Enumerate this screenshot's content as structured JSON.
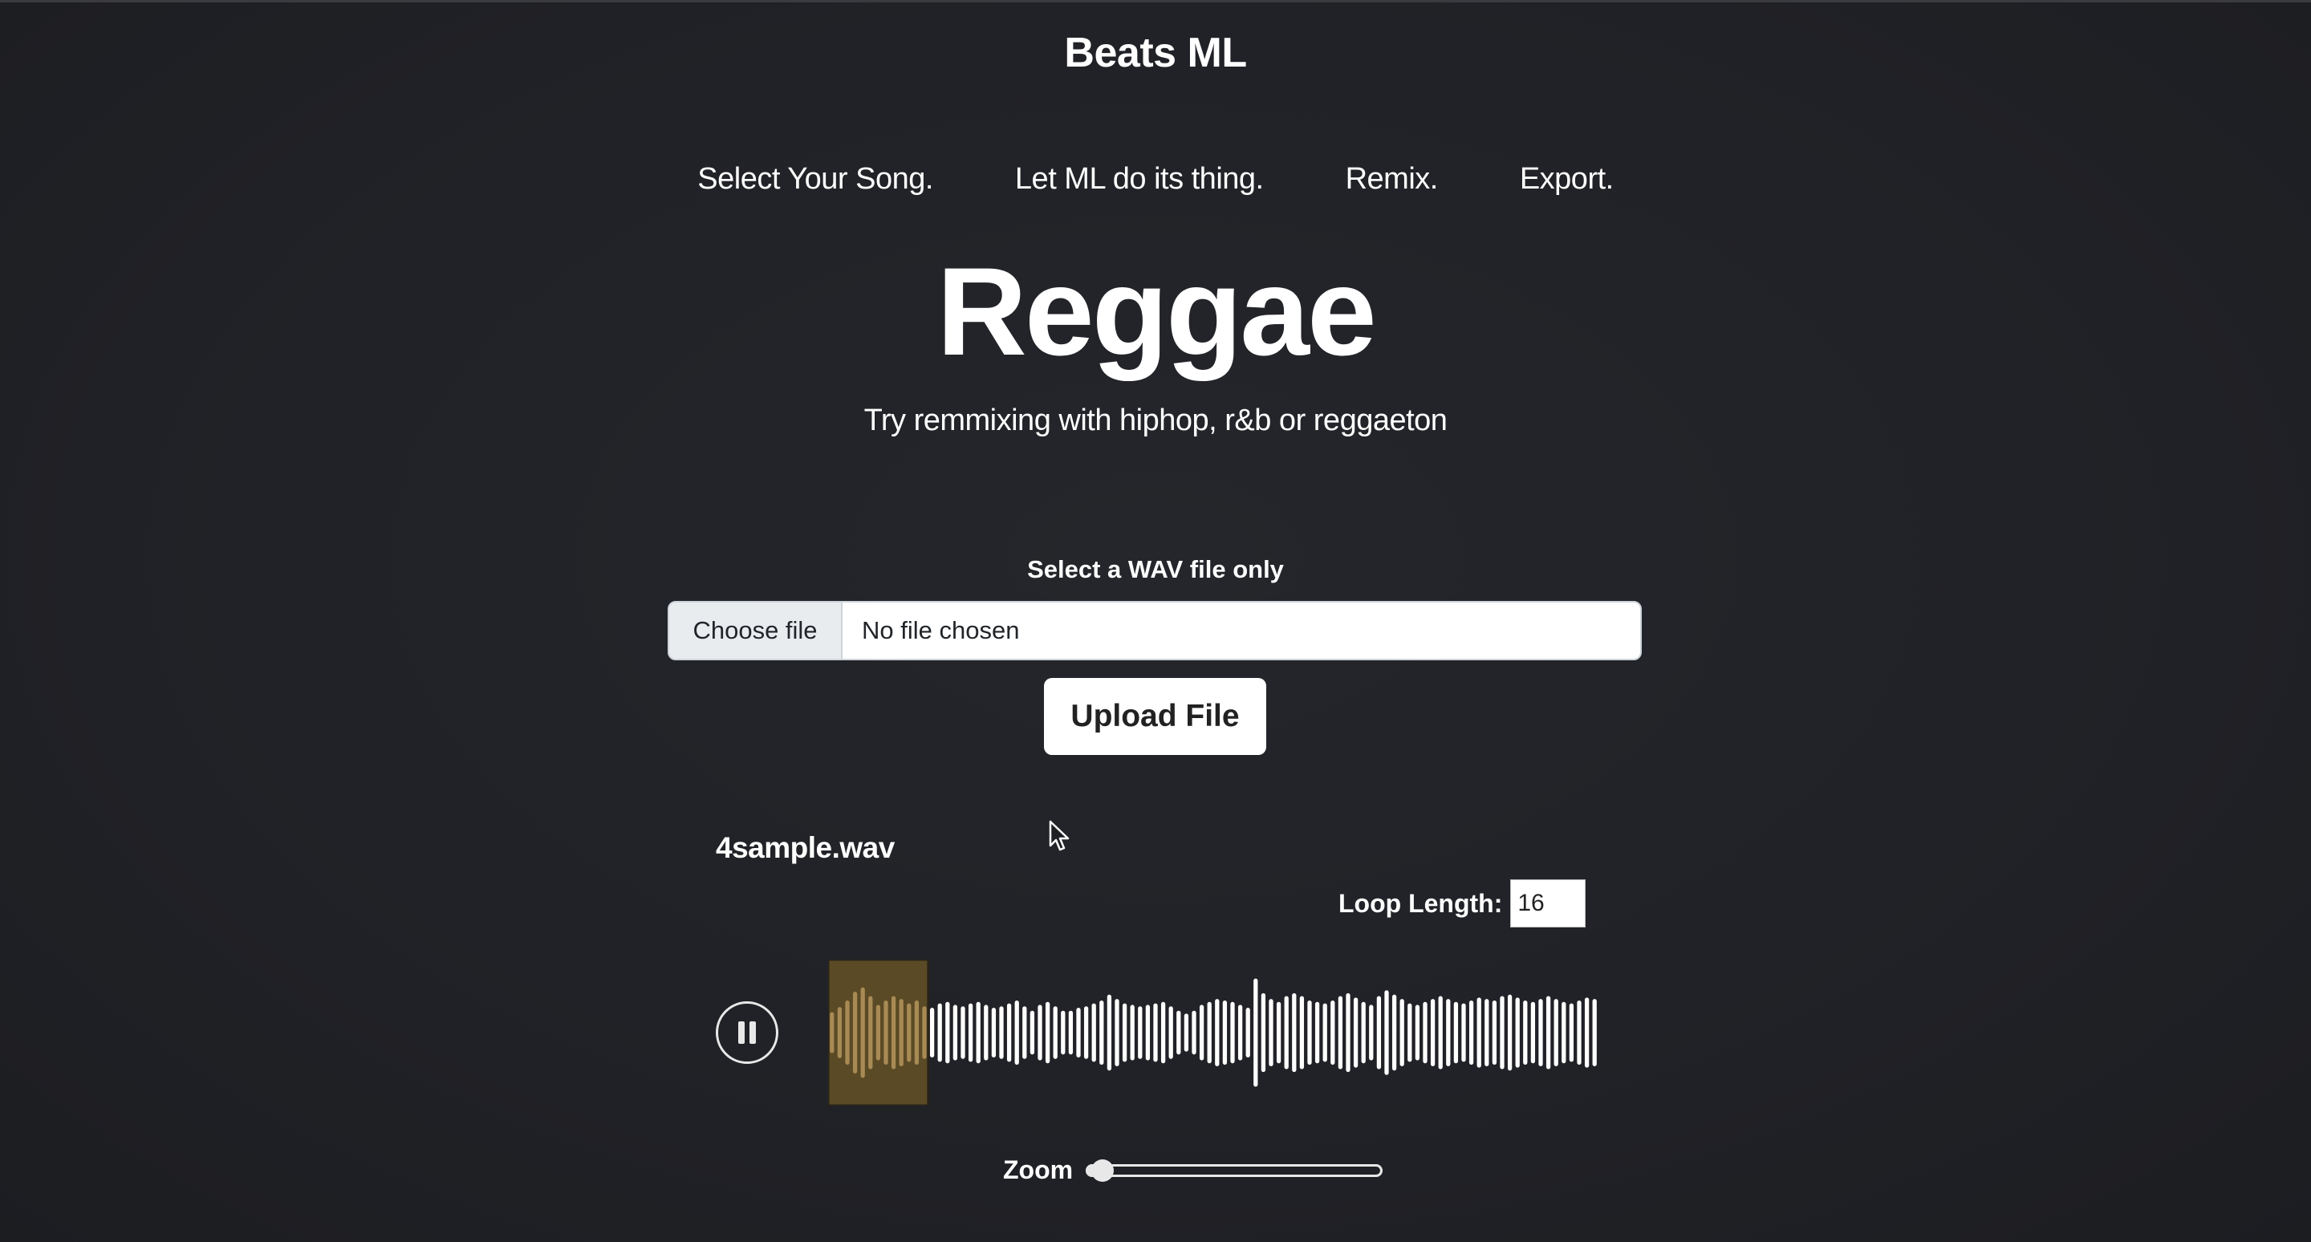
{
  "app": {
    "title": "Beats ML"
  },
  "nav": {
    "steps": [
      "Select Your Song.",
      "Let ML do its thing.",
      "Remix.",
      "Export."
    ]
  },
  "hero": {
    "genre": "Reggae",
    "subtitle": "Try remmixing with hiphop, r&b or reggaeton"
  },
  "upload": {
    "label": "Select a WAV file only",
    "choose_label": "Choose file",
    "status": "No file chosen",
    "button_label": "Upload File"
  },
  "player": {
    "filename": "4sample.wav",
    "loop_label": "Loop Length:",
    "loop_value": "16",
    "zoom_label": "Zoom",
    "zoom_level": 0.02,
    "selection_start_fraction": 0.0,
    "selection_end_fraction": 0.13,
    "waveform_levels": [
      0.28,
      0.35,
      0.44,
      0.56,
      0.62,
      0.5,
      0.38,
      0.44,
      0.5,
      0.46,
      0.4,
      0.44,
      0.36,
      0.34,
      0.4,
      0.42,
      0.38,
      0.36,
      0.4,
      0.42,
      0.38,
      0.34,
      0.36,
      0.4,
      0.44,
      0.36,
      0.3,
      0.38,
      0.42,
      0.36,
      0.3,
      0.3,
      0.34,
      0.36,
      0.4,
      0.44,
      0.52,
      0.46,
      0.4,
      0.38,
      0.36,
      0.38,
      0.4,
      0.42,
      0.36,
      0.3,
      0.26,
      0.3,
      0.38,
      0.42,
      0.46,
      0.44,
      0.42,
      0.38,
      0.34,
      0.74,
      0.54,
      0.46,
      0.42,
      0.5,
      0.54,
      0.5,
      0.44,
      0.42,
      0.4,
      0.44,
      0.5,
      0.54,
      0.48,
      0.42,
      0.38,
      0.5,
      0.58,
      0.52,
      0.46,
      0.4,
      0.38,
      0.42,
      0.46,
      0.5,
      0.46,
      0.42,
      0.4,
      0.44,
      0.48,
      0.46,
      0.44,
      0.5,
      0.52,
      0.48,
      0.44,
      0.42,
      0.46,
      0.5,
      0.46,
      0.42,
      0.4,
      0.44,
      0.48,
      0.46
    ],
    "colors": {
      "bar": "#ffffff",
      "selection_bg": "#5a4a25",
      "selection_bar": "#a88a55"
    }
  }
}
